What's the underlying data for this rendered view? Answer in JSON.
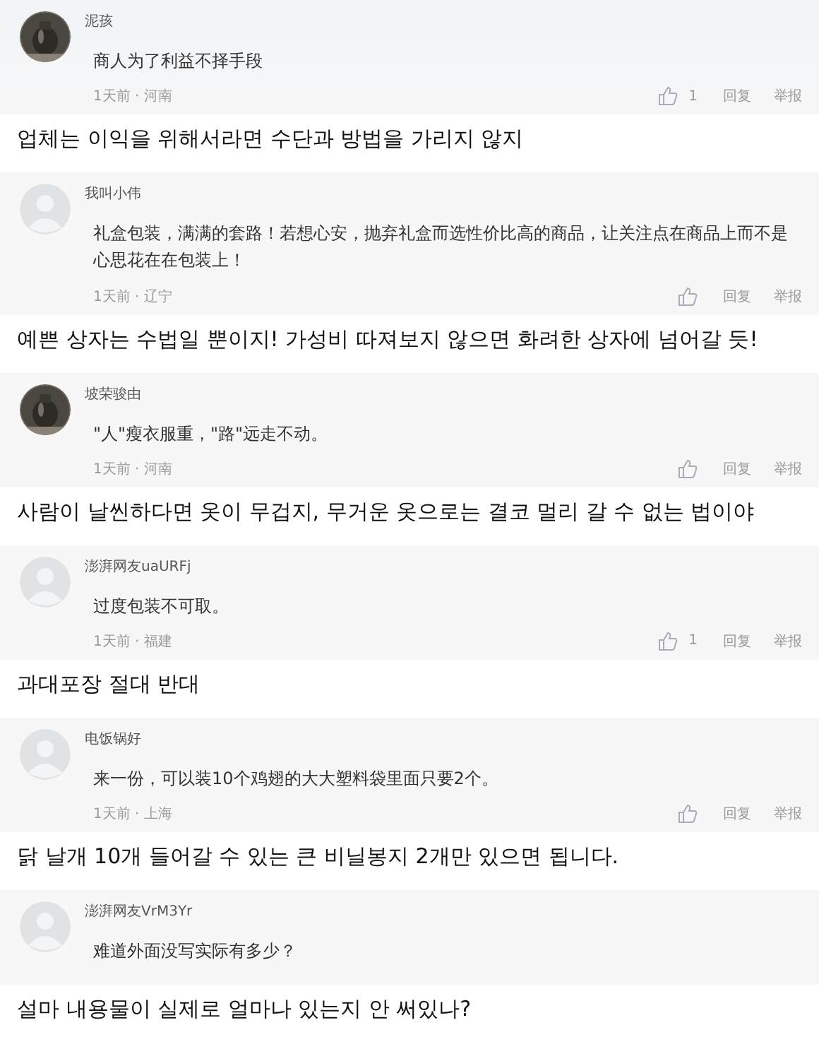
{
  "comments": [
    {
      "user": "泥孩",
      "text": "商人为了利益不择手段",
      "meta": "1天前 · 河南",
      "likes": "1",
      "reply": "回复",
      "report": "举报",
      "translation": "업체는 이익을 위해서라면 수단과 방법을 가리지 않지"
    },
    {
      "avatar": {
        "kind": "default"
      },
      "user": "我叫小伟",
      "text": "礼盒包装，满满的套路！若想心安，抛弃礼盒而选性价比高的商品，让关注点在商品上而不是心思花在在包装上！",
      "meta": "1天前 · 辽宁",
      "reply": "回复",
      "report": "举报",
      "translation": "예쁜 상자는 수법일 뿐이지! 가성비 따져보지 않으면 화려한 상자에 넘어갈 듯!"
    },
    {
      "user": "坡荣骏由",
      "text": "\"人\"瘦衣服重，\"路\"远走不动。",
      "meta": "1天前 · 河南",
      "reply": "回复",
      "report": "举报",
      "translation": "사람이 날씬하다면 옷이 무겁지, 무거운 옷으로는 결코 멀리 갈 수 없는 법이야"
    },
    {
      "avatar": {
        "kind": "default"
      },
      "user": "澎湃网友uaURFj",
      "text": "过度包装不可取。",
      "meta": "1天前 · 福建",
      "likes": "1",
      "reply": "回复",
      "report": "举报",
      "translation": "과대포장 절대 반대"
    },
    {
      "avatar": {
        "kind": "default"
      },
      "user": "电饭锅好",
      "text": "来一份，可以装10个鸡翅的大大塑料袋里面只要2个。",
      "meta": "1天前 · 上海",
      "reply": "回复",
      "report": "举报",
      "translation": "닭 날개 10개 들어갈 수 있는 큰 비닐봉지 2개만 있으면 됩니다."
    },
    {
      "avatar": {
        "kind": "default"
      },
      "user": "澎湃网友VrM3Yr",
      "text": "难道外面没写实际有多少？",
      "translation": "설마 내용물이 실제로 얼마나 있는지 안 써있나?"
    }
  ]
}
